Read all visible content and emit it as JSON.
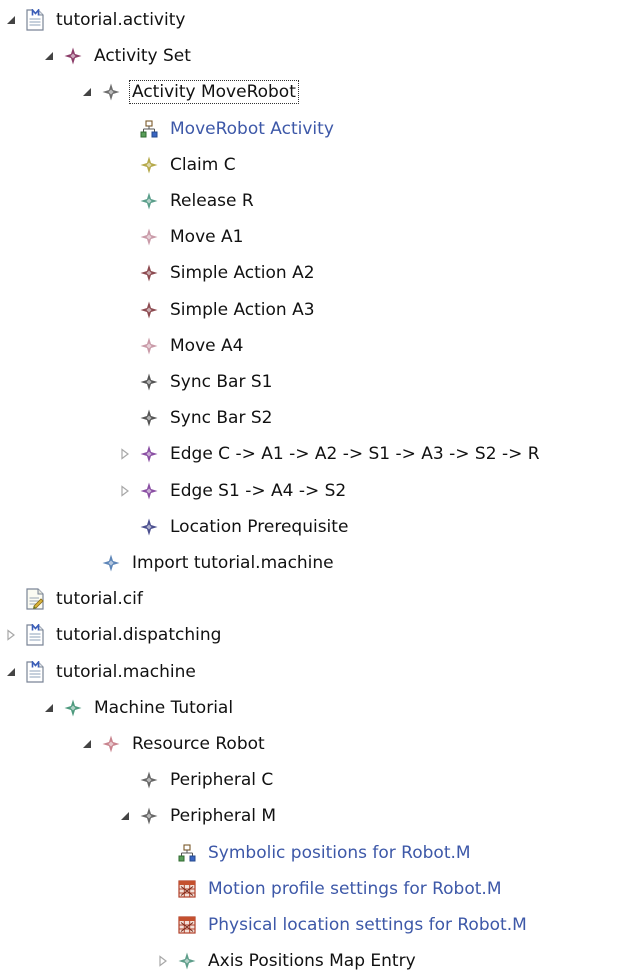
{
  "colors": {
    "text": "#111111",
    "link_text": "#3d58a8",
    "twisty": "#444444",
    "twisty_collapsed": "#a8a8a8"
  },
  "tree": [
    {
      "label": "tutorial.activity",
      "level": 0,
      "twisty": "expanded",
      "icon": "model-file-icon"
    },
    {
      "label": "Activity Set",
      "level": 1,
      "twisty": "expanded",
      "icon": "diamond-star-icon",
      "icon_color": "#8c3e6a"
    },
    {
      "label": "Activity MoveRobot",
      "level": 2,
      "twisty": "expanded",
      "icon": "diamond-star-icon",
      "icon_color": "#6e6e6e",
      "focused": true
    },
    {
      "label": "MoveRobot Activity",
      "level": 3,
      "twisty": "none",
      "icon": "hierarchy-diagram-icon",
      "link": true
    },
    {
      "label": "Claim C",
      "level": 3,
      "twisty": "none",
      "icon": "diamond-star-icon",
      "icon_color": "#b5a94a"
    },
    {
      "label": "Release R",
      "level": 3,
      "twisty": "none",
      "icon": "diamond-star-icon",
      "icon_color": "#5a9e8a"
    },
    {
      "label": "Move A1",
      "level": 3,
      "twisty": "none",
      "icon": "diamond-star-icon",
      "icon_color": "#c99aa8"
    },
    {
      "label": "Simple Action A2",
      "level": 3,
      "twisty": "none",
      "icon": "diamond-star-icon",
      "icon_color": "#8c4a50"
    },
    {
      "label": "Simple Action A3",
      "level": 3,
      "twisty": "none",
      "icon": "diamond-star-icon",
      "icon_color": "#8c4a50"
    },
    {
      "label": "Move A4",
      "level": 3,
      "twisty": "none",
      "icon": "diamond-star-icon",
      "icon_color": "#c99aa8"
    },
    {
      "label": "Sync Bar S1",
      "level": 3,
      "twisty": "none",
      "icon": "diamond-star-icon",
      "icon_color": "#555555"
    },
    {
      "label": "Sync Bar S2",
      "level": 3,
      "twisty": "none",
      "icon": "diamond-star-icon",
      "icon_color": "#555555"
    },
    {
      "label": "Edge C -> A1 -> A2 -> S1 -> A3 -> S2 -> R",
      "level": 3,
      "twisty": "collapsed",
      "icon": "diamond-star-icon",
      "icon_color": "#8a4fa3"
    },
    {
      "label": "Edge S1 -> A4 -> S2",
      "level": 3,
      "twisty": "collapsed",
      "icon": "diamond-star-icon",
      "icon_color": "#8a4fa3"
    },
    {
      "label": "Location Prerequisite",
      "level": 3,
      "twisty": "none",
      "icon": "diamond-star-icon",
      "icon_color": "#4b4f8f"
    },
    {
      "label": "Import tutorial.machine",
      "level": 2,
      "twisty": "none",
      "icon": "diamond-star-icon",
      "icon_color": "#5e86b8"
    },
    {
      "label": "tutorial.cif",
      "level": 0,
      "twisty": "none",
      "icon": "text-file-icon"
    },
    {
      "label": "tutorial.dispatching",
      "level": 0,
      "twisty": "collapsed",
      "icon": "model-file-icon"
    },
    {
      "label": "tutorial.machine",
      "level": 0,
      "twisty": "expanded",
      "icon": "model-file-icon"
    },
    {
      "label": "Machine Tutorial",
      "level": 1,
      "twisty": "expanded",
      "icon": "diamond-star-icon",
      "icon_color": "#4e9a7e"
    },
    {
      "label": "Resource Robot",
      "level": 2,
      "twisty": "expanded",
      "icon": "diamond-star-icon",
      "icon_color": "#c9848e"
    },
    {
      "label": "Peripheral C",
      "level": 3,
      "twisty": "none",
      "icon": "diamond-star-icon",
      "icon_color": "#666666"
    },
    {
      "label": "Peripheral M",
      "level": 3,
      "twisty": "expanded",
      "icon": "diamond-star-icon",
      "icon_color": "#666666"
    },
    {
      "label": "Symbolic positions for Robot.M",
      "level": 4,
      "twisty": "none",
      "icon": "hierarchy-diagram-icon",
      "link": true
    },
    {
      "label": "Motion profile settings for Robot.M",
      "level": 4,
      "twisty": "none",
      "icon": "settings-table-icon",
      "link": true
    },
    {
      "label": "Physical location settings for Robot.M",
      "level": 4,
      "twisty": "none",
      "icon": "settings-table-icon",
      "link": true
    },
    {
      "label": "Axis Positions Map Entry",
      "level": 4,
      "twisty": "collapsed",
      "icon": "diamond-star-icon",
      "icon_color": "#5e9e8a"
    }
  ]
}
